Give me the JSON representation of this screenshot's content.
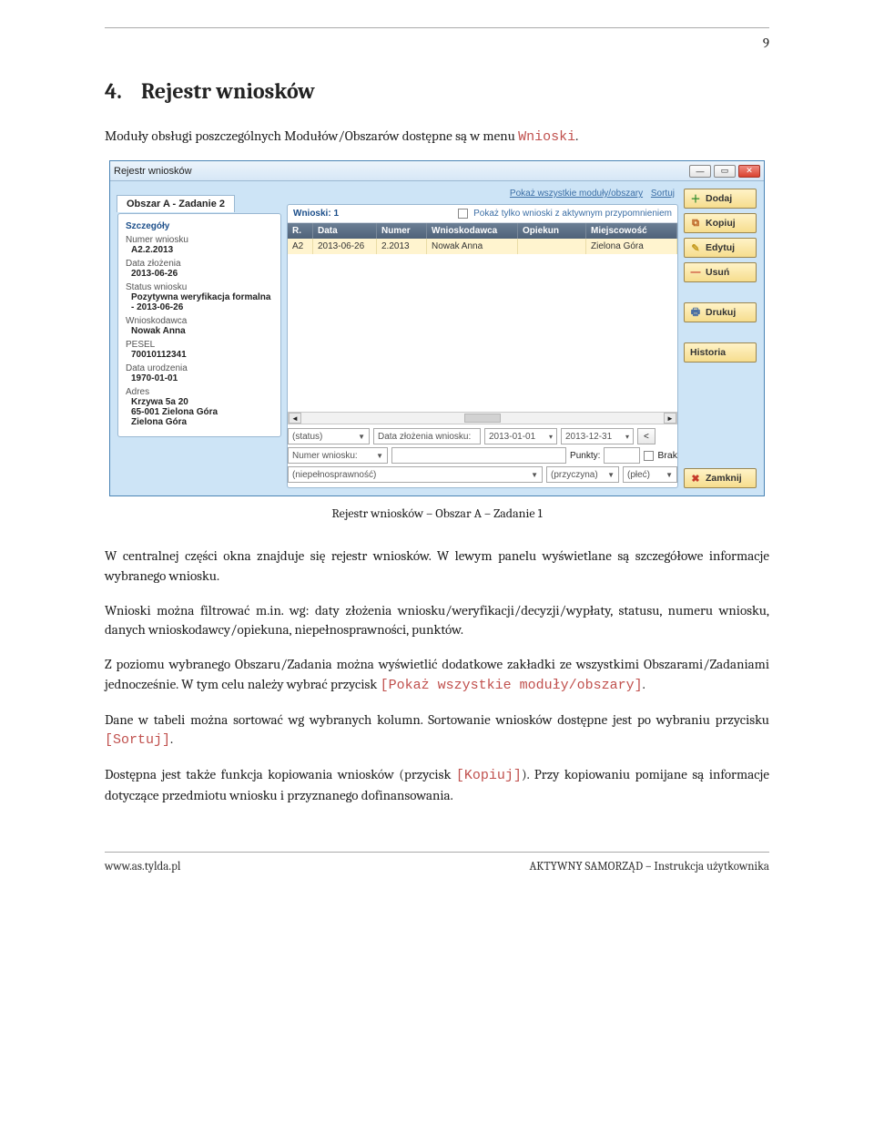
{
  "page": {
    "number": "9"
  },
  "section": {
    "num": "4.",
    "title": "Rejestr wniosków"
  },
  "intro": {
    "text_before": "Moduły obsługi poszczególnych Modułów/Obszarów dostępne są w menu ",
    "menu_name": "Wnioski",
    "text_after": "."
  },
  "app": {
    "window_title": "Rejestr wniosków",
    "tab_title": "Obszar A - Zadanie 2",
    "toolbar_links": {
      "show_all": "Pokaż wszystkie moduły/obszary",
      "sort": "Sortuj"
    },
    "details": {
      "header": "Szczegóły",
      "fields": {
        "numer_wniosku_lbl": "Numer wniosku",
        "numer_wniosku": "A2.2.2013",
        "data_zlozenia_lbl": "Data złożenia",
        "data_zlozenia": "2013-06-26",
        "status_lbl": "Status wniosku",
        "status": "Pozytywna weryfikacja formalna - 2013-06-26",
        "wnioskodawca_lbl": "Wnioskodawca",
        "wnioskodawca": "Nowak Anna",
        "pesel_lbl": "PESEL",
        "pesel": "70010112341",
        "urodz_lbl": "Data urodzenia",
        "urodz": "1970-01-01",
        "adres_lbl": "Adres",
        "adres1": "Krzywa 5a 20",
        "adres2": "65-001 Zielona Góra",
        "adres3": "Zielona Góra"
      }
    },
    "list": {
      "title": "Wnioski:  1",
      "checkbox_label": "Pokaż tylko wnioski z aktywnym przypomnieniem",
      "headers": {
        "r": "R.",
        "data": "Data",
        "numer": "Numer",
        "wnioskodawca": "Wnioskodawca",
        "opiekun": "Opiekun",
        "miejsc": "Miejscowość"
      },
      "row1": {
        "r": "A2",
        "data": "2013-06-26",
        "numer": "2.2013",
        "wnioskodawca": "Nowak Anna",
        "opiekun": "",
        "miejsc": "Zielona Góra"
      }
    },
    "filters": {
      "status": "(status)",
      "data_label": "Data złożenia wniosku:",
      "date_from": "2013-01-01",
      "date_to": "2013-12-31",
      "lt": "<",
      "numer_label": "Numer wniosku:",
      "punkty_label": "Punkty:",
      "brak": "Brak",
      "niep": "(niepełnosprawność)",
      "przyczyna": "(przyczyna)",
      "plec": "(płeć)"
    },
    "buttons": {
      "dodaj": "Dodaj",
      "kopiuj": "Kopiuj",
      "edytuj": "Edytuj",
      "usun": "Usuń",
      "drukuj": "Drukuj",
      "historia": "Historia",
      "zamknij": "Zamknij"
    }
  },
  "caption": "Rejestr wniosków – Obszar A – Zadanie 1",
  "para1": "W centralnej części okna znajduje się rejestr wniosków. W lewym panelu wyświetlane są szczegółowe informacje wybranego wniosku.",
  "para2": "Wnioski można filtrować m.in. wg: daty złożenia wniosku/weryfikacji/decyzji/wypłaty, statusu, numeru wniosku, danych wnioskodawcy/opiekuna, niepełnosprawności, punktów.",
  "para3": {
    "a": "Z poziomu wybranego Obszaru/Zadania można wyświetlić dodatkowe zakładki ze wszystkimi Obszarami/Zadaniami jednocześnie. W tym celu należy wybrać przycisk ",
    "btn": "[Pokaż wszystkie moduły/obszary]",
    "b": "."
  },
  "para4": {
    "a": "Dane w tabeli można sortować wg wybranych kolumn. Sortowanie wniosków dostępne jest po wybraniu przycisku ",
    "btn": "[Sortuj]",
    "b": "."
  },
  "para5": {
    "a": "Dostępna jest także funkcja kopiowania wniosków (przycisk ",
    "btn": "[Kopiuj]",
    "b": "). Przy kopiowaniu pomijane są informacje dotyczące przedmiotu wniosku i przyznanego dofinansowania."
  },
  "footer": {
    "left": "www.as.tylda.pl",
    "right": "AKTYWNY SAMORZĄD – Instrukcja użytkownika"
  }
}
